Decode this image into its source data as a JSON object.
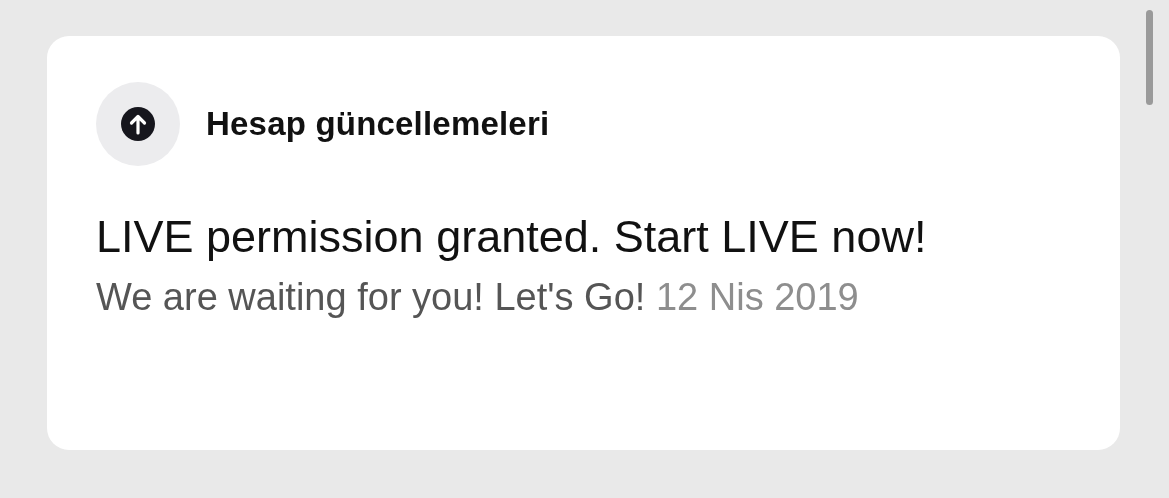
{
  "notification": {
    "category": "Hesap güncellemeleri",
    "title": "LIVE permission granted. Start LIVE now!",
    "message": "We are waiting for you! Let's Go!",
    "date": "12 Nis 2019"
  }
}
